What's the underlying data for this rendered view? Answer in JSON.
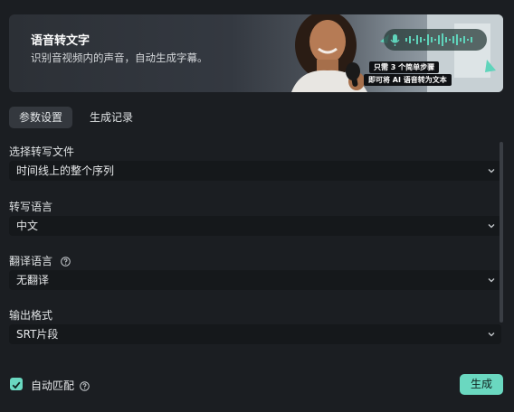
{
  "banner": {
    "title": "语音转文字",
    "subtitle": "识别音视频内的声音，自动生成字幕。",
    "badge_line1": "只需 3 个简单步骤",
    "badge_line2": "即可将 AI 语音转为文本"
  },
  "tabs": [
    {
      "label": "参数设置",
      "active": true
    },
    {
      "label": "生成记录",
      "active": false
    }
  ],
  "fields": {
    "source": {
      "label": "选择转写文件",
      "value": "时间线上的整个序列"
    },
    "language": {
      "label": "转写语言",
      "value": "中文"
    },
    "translate": {
      "label": "翻译语言",
      "value": "无翻译"
    },
    "format": {
      "label": "输出格式",
      "value": "SRT片段"
    }
  },
  "footer": {
    "auto_match_label": "自动匹配",
    "auto_match_checked": true,
    "generate_label": "生成"
  },
  "colors": {
    "accent": "#6ad8c0",
    "background": "#1b1e22",
    "field_bg": "#15181b"
  }
}
